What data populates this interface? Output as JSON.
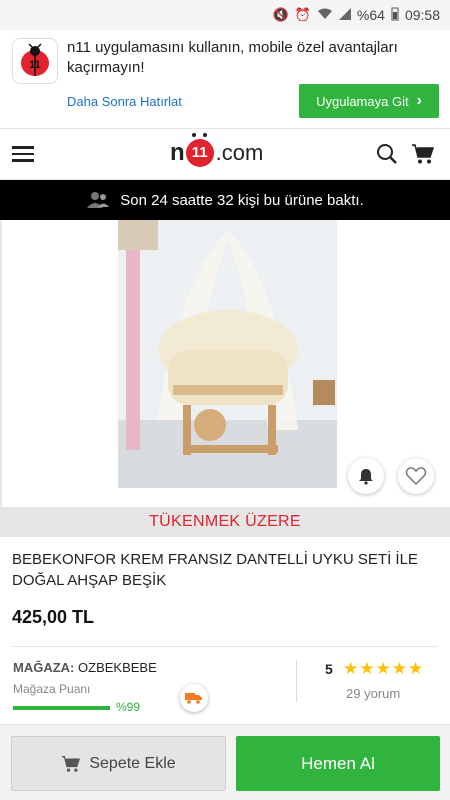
{
  "status_bar": {
    "battery": "%64",
    "time": "09:58"
  },
  "app_banner": {
    "message": "n11 uygulamasını kullanın, mobile özel avantajları kaçırmayın!",
    "later_label": "Daha Sonra Hatırlat",
    "go_app_label": "Uygulamaya Git"
  },
  "header": {
    "logo_n": "n",
    "logo_11": "11",
    "logo_domain": ".com"
  },
  "visitors": {
    "text": "Son 24 saatte 32 kişi bu ürüne baktı."
  },
  "product": {
    "stock_status": "TÜKENMEK ÜZERE",
    "title": "BEBEKONFOR KREM FRANSIZ DANTELLİ UYKU SETİ İLE DOĞAL AHŞAP BEŞİK",
    "price": "425,00 TL"
  },
  "store": {
    "label": "MAĞAZA:",
    "name": "OZBEKBEBE",
    "score_label": "Mağaza Puanı",
    "score_value": "%99",
    "score_fraction": 0.99
  },
  "rating": {
    "value": "5",
    "stars": 5,
    "reviews": "29 yorum"
  },
  "actions": {
    "add_to_cart": "Sepete Ekle",
    "buy_now": "Hemen Al"
  },
  "colors": {
    "brand_green": "#30b43d",
    "alert_red": "#e0232e",
    "star_yellow": "#ffc107",
    "link_blue": "#1a73c9"
  }
}
